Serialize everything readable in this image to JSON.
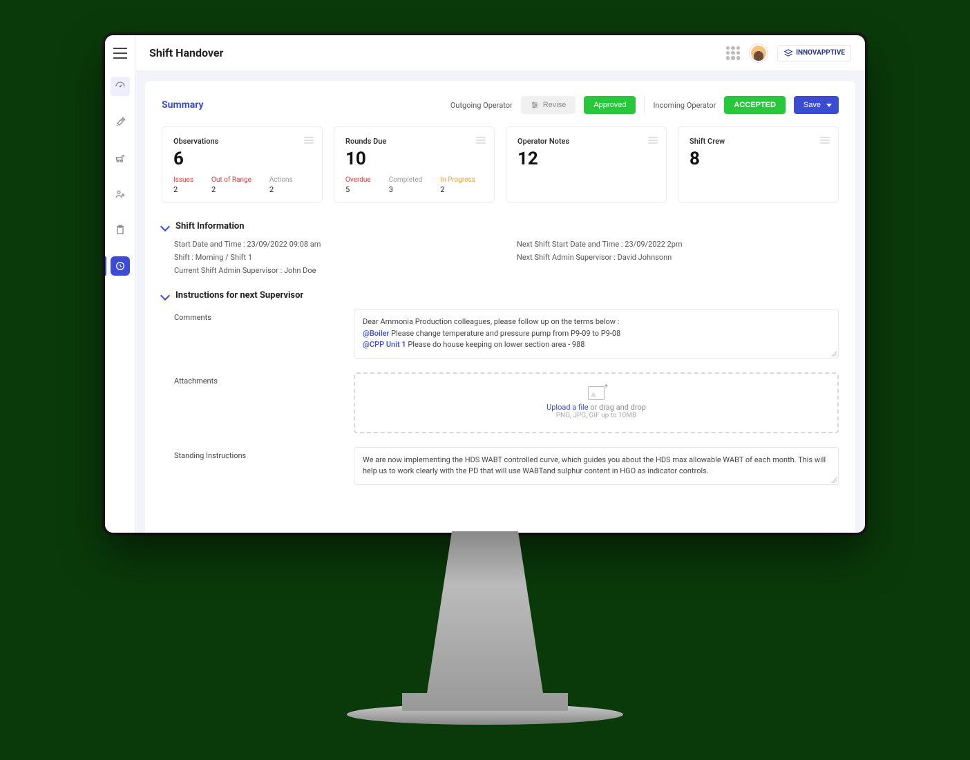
{
  "header": {
    "title": "Shift Handover",
    "brand": "INNOVAPPTIVE"
  },
  "summary": {
    "title": "Summary",
    "outgoing_label": "Outgoing Operator",
    "revise_label": "Revise",
    "approved_label": "Approved",
    "incoming_label": "Incoming Operator",
    "accepted_label": "ACCEPTED",
    "save_label": "Save"
  },
  "cards": {
    "observations": {
      "title": "Observations",
      "value": "6",
      "subs": [
        {
          "label": "Issues",
          "value": "2",
          "cls": "red"
        },
        {
          "label": "Out of Range",
          "value": "2",
          "cls": "red"
        },
        {
          "label": "Actions",
          "value": "2",
          "cls": "gray"
        }
      ]
    },
    "rounds": {
      "title": "Rounds Due",
      "value": "10",
      "subs": [
        {
          "label": "Overdue",
          "value": "5",
          "cls": "red"
        },
        {
          "label": "Completed",
          "value": "3",
          "cls": "gray"
        },
        {
          "label": "In Progress",
          "value": "2",
          "cls": "orange"
        }
      ]
    },
    "notes": {
      "title": "Operator Notes",
      "value": "12"
    },
    "crew": {
      "title": "Shift Crew",
      "value": "8"
    }
  },
  "shift_info": {
    "heading": "Shift Information",
    "start": "Start Date and Time : 23/09/2022 09:08 am",
    "shift": "Shift  : Morning / Shift 1",
    "current_sup": "Current Shift Admin Supervisor : John Doe",
    "next_start": "Next Shift Start Date and Time  : 23/09/2022 2pm",
    "next_sup": "Next Shift Admin Supervisor : David Johnsonn"
  },
  "instructions": {
    "heading": "Instructions for next Supervisor",
    "comments_label": "Comments",
    "comments_intro": "Dear Ammonia Production colleagues, please follow up on the terms below :",
    "comments_l2_mention": "@Boiler",
    "comments_l2_rest": " Please change temperature and pressure pump from P9-09 to P9-08",
    "comments_l3_mention": "@CPP Unit 1",
    "comments_l3_rest": " Please do house keeping on lower section area - 988",
    "attachments_label": "Attachments",
    "upload_link": "Upload a file",
    "upload_rest": " or drag and drop",
    "upload_hint": "PNG, JPG, GIF up to 10MB",
    "standing_label": "Standing Instructions",
    "standing_text": "We are now implementing the HDS WABT controlled curve, which guides you about the HDS max allowable WABT of each month. This will help us to work clearly with the PD that will use WABTand sulphur content in HGO as indicator controls."
  }
}
